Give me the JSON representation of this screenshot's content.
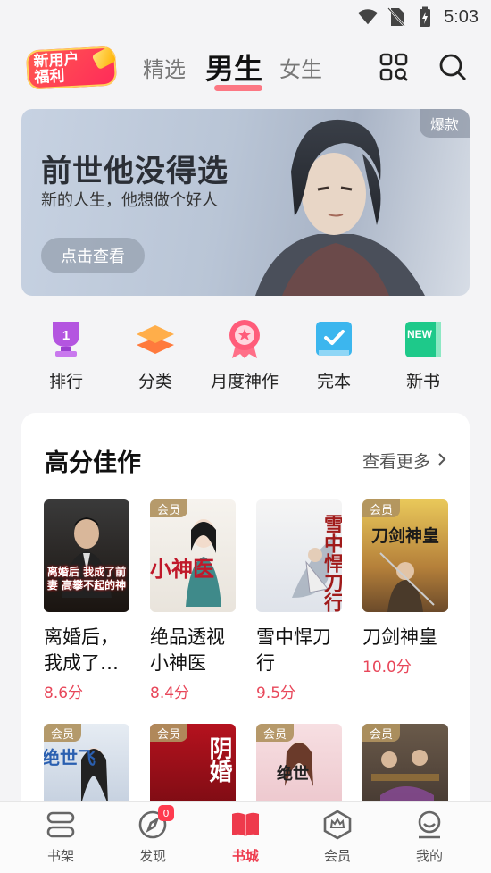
{
  "status_bar": {
    "time": "5:03"
  },
  "top_nav": {
    "promo_line1": "新用户",
    "promo_line2": "福利",
    "tabs": [
      {
        "label": "精选",
        "active": false
      },
      {
        "label": "男生",
        "active": true
      },
      {
        "label": "女生",
        "active": false
      }
    ]
  },
  "banner": {
    "title": "前世他没得选",
    "subtitle": "新的人生，他想做个好人",
    "button": "点击查看",
    "tag": "爆款"
  },
  "quick_links": [
    {
      "label": "排行",
      "icon": "trophy-icon"
    },
    {
      "label": "分类",
      "icon": "layers-icon"
    },
    {
      "label": "月度神作",
      "icon": "star-medal-icon"
    },
    {
      "label": "完本",
      "icon": "book-check-icon"
    },
    {
      "label": "新书",
      "icon": "new-book-icon"
    }
  ],
  "section": {
    "title": "高分佳作",
    "more": "查看更多",
    "vip_label": "会员",
    "books": [
      {
        "name": "离婚后，我成了…",
        "score": "8.6分",
        "vip": false,
        "cover_text": "离婚后 我成了前妻 高攀不起的神"
      },
      {
        "name": "绝品透视小神医",
        "score": "8.4分",
        "vip": true,
        "cover_text": "小神医"
      },
      {
        "name": "雪中悍刀行",
        "score": "9.5分",
        "vip": false,
        "cover_text": "雪中悍刀行"
      },
      {
        "name": "刀剑神皇",
        "score": "10.0分",
        "vip": true,
        "cover_text": "刀剑神皇"
      }
    ],
    "books_row2": [
      {
        "vip": true,
        "cover_text": "绝世飞"
      },
      {
        "vip": true,
        "cover_text": "阴婚"
      },
      {
        "vip": true,
        "cover_text": "绝世"
      },
      {
        "vip": true,
        "cover_text": ""
      }
    ]
  },
  "bottom_nav": {
    "badge": "0",
    "items": [
      {
        "label": "书架",
        "active": false
      },
      {
        "label": "发现",
        "active": false
      },
      {
        "label": "书城",
        "active": true
      },
      {
        "label": "会员",
        "active": false
      },
      {
        "label": "我的",
        "active": false
      }
    ]
  },
  "colors": {
    "accent": "#ee3a4c",
    "score": "#e8475a",
    "vip": "#b09260"
  }
}
